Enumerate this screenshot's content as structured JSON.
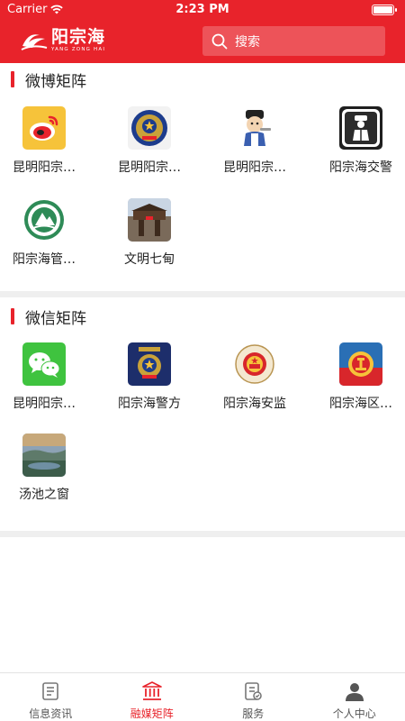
{
  "status": {
    "carrier": "Carrier",
    "time": "2:23 PM"
  },
  "header": {
    "logo_cn": "阳宗海",
    "logo_en": "YANG ZONG HAI",
    "search_placeholder": "搜索"
  },
  "weibo": {
    "title": "微博矩阵",
    "items": [
      {
        "label": "昆明阳宗…",
        "icon": "weibo-icon"
      },
      {
        "label": "昆明阳宗…",
        "icon": "police-badge-icon"
      },
      {
        "label": "昆明阳宗…",
        "icon": "cartoon-judge-icon"
      },
      {
        "label": "阳宗海交警",
        "icon": "traffic-police-icon"
      },
      {
        "label": "阳宗海管…",
        "icon": "environment-emblem-icon"
      },
      {
        "label": "文明七甸",
        "icon": "gate-photo-icon"
      }
    ]
  },
  "wechat": {
    "title": "微信矩阵",
    "items": [
      {
        "label": "昆明阳宗…",
        "icon": "wechat-icon"
      },
      {
        "label": "阳宗海警方",
        "icon": "police-badge-icon"
      },
      {
        "label": "阳宗海安监",
        "icon": "national-emblem-icon"
      },
      {
        "label": "阳宗海区…",
        "icon": "union-emblem-icon"
      },
      {
        "label": "汤池之窗",
        "icon": "lake-photo-icon"
      }
    ]
  },
  "tabs": [
    {
      "label": "信息资讯",
      "icon": "news-icon",
      "active": false
    },
    {
      "label": "融媒矩阵",
      "icon": "building-icon",
      "active": true
    },
    {
      "label": "服务",
      "icon": "service-icon",
      "active": false
    },
    {
      "label": "个人中心",
      "icon": "person-icon",
      "active": false
    }
  ],
  "colors": {
    "brand": "#e8232b",
    "band": "#efefef"
  }
}
